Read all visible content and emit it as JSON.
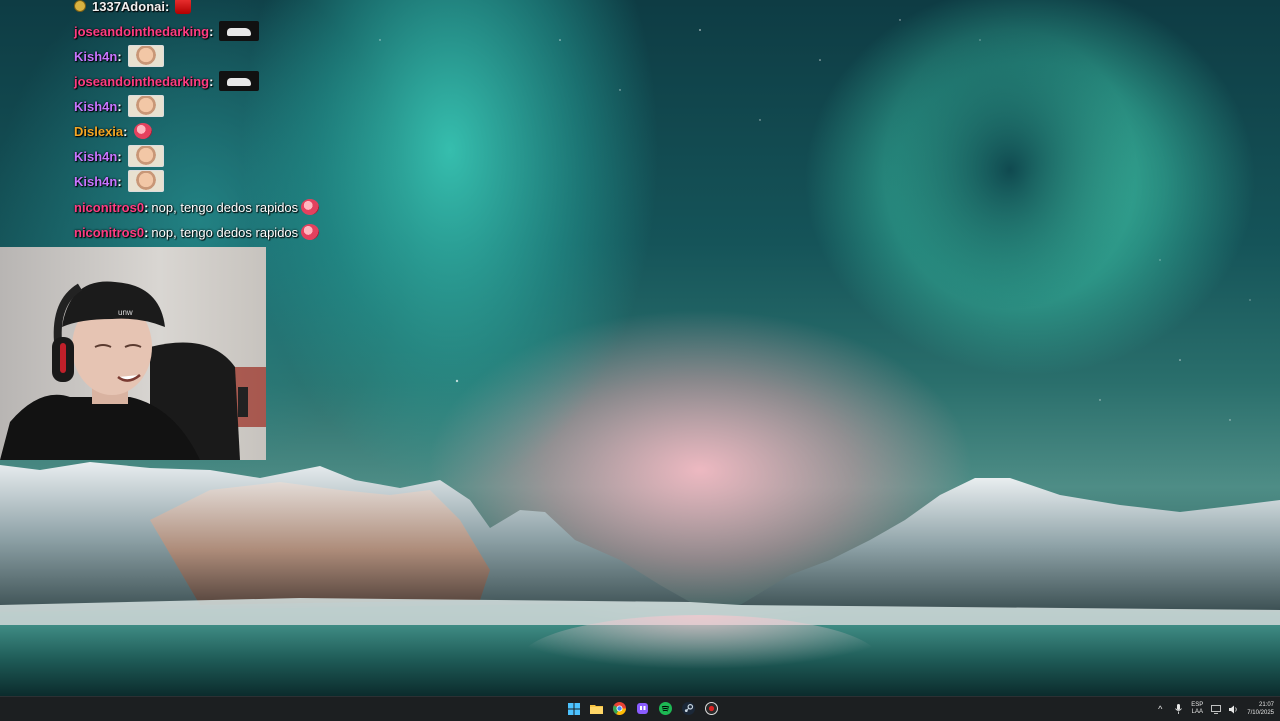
{
  "chat": {
    "messages": [
      {
        "user": "1337Adonai",
        "user_color": "#f0f0f0",
        "text": "",
        "emote": "shoe-emote",
        "badge": true
      },
      {
        "user": "joseandointhedarking",
        "user_color": "#ff3c82",
        "text": "",
        "emote": "car-emote"
      },
      {
        "user": "Kish4n",
        "user_color": "#c774ff",
        "text": "",
        "emote": "face-emote"
      },
      {
        "user": "joseandointhedarking",
        "user_color": "#ff3c82",
        "text": "",
        "emote": "car-emote"
      },
      {
        "user": "Kish4n",
        "user_color": "#c774ff",
        "text": "",
        "emote": "face-emote"
      },
      {
        "user": "Dislexia",
        "user_color": "#f4a623",
        "text": "",
        "emote": "heart-emote"
      },
      {
        "user": "Kish4n",
        "user_color": "#c774ff",
        "text": "",
        "emote": "face-emote"
      },
      {
        "user": "Kish4n",
        "user_color": "#c774ff",
        "text": "",
        "emote": "face-emote"
      },
      {
        "user": "niconitros0",
        "user_color": "#ff3c82",
        "text": "nop, tengo dedos rapidos",
        "emote": "heart-emote"
      },
      {
        "user": "niconitros0",
        "user_color": "#ff3c82",
        "text": "nop, tengo dedos rapidos",
        "emote": "heart-emote"
      }
    ]
  },
  "taskbar": {
    "apps": [
      {
        "name": "start-button",
        "icon": "windows-icon",
        "color": "#4cc2ff"
      },
      {
        "name": "file-explorer-button",
        "icon": "folder-icon",
        "color": "#f5c242"
      },
      {
        "name": "chrome-button",
        "icon": "chrome-icon",
        "color": "#e94235"
      },
      {
        "name": "twitch-app-button",
        "icon": "app-icon",
        "color": "#8a5cff"
      },
      {
        "name": "spotify-button",
        "icon": "spotify-icon",
        "color": "#1db954"
      },
      {
        "name": "steam-button",
        "icon": "steam-icon",
        "color": "#6aa6d6"
      },
      {
        "name": "obs-button",
        "icon": "record-icon",
        "color": "#d23"
      }
    ],
    "tray": {
      "language_top": "ESP",
      "language_bottom": "LAA",
      "time": "21:07",
      "date": "7/10/2025"
    }
  }
}
